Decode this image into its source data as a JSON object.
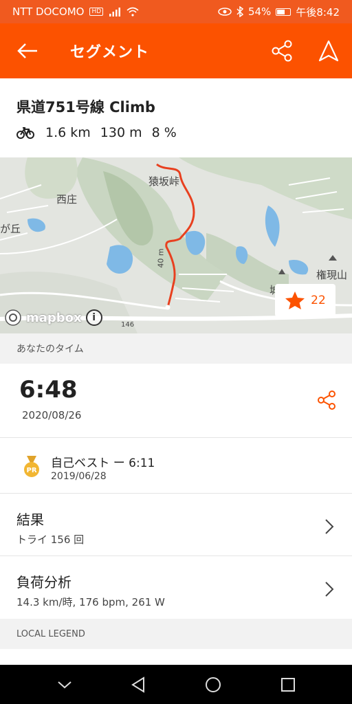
{
  "status_bar": {
    "carrier": "NTT DOCOMO",
    "hd": "HD",
    "battery": "54%",
    "battery_level": 0.54,
    "time": "午後8:42"
  },
  "app_bar": {
    "title": "セグメント"
  },
  "segment": {
    "name": "県道751号線 Climb",
    "distance": "1.6 km",
    "elevation": "130 m",
    "grade": "8 %"
  },
  "map": {
    "labels": {
      "nishi": "西庄",
      "ga_oka": "が丘",
      "sarusaka": "猿坂峠",
      "gongen": "権現山",
      "shiro": "城",
      "road": "146",
      "elev": "40 m"
    },
    "star_count": "22",
    "attribution": "mapbox",
    "route_color": "#e8401f"
  },
  "your_time": {
    "header": "あなたのタイム",
    "time": "6:48",
    "date": "2020/08/26"
  },
  "pr": {
    "badge": "PR",
    "title": "自己ベスト ー 6:11",
    "date": "2019/06/28"
  },
  "results": {
    "title": "結果",
    "sub": "トライ 156 回"
  },
  "analysis": {
    "title": "負荷分析",
    "sub": "14.3 km/時, 176 bpm, 261 W"
  },
  "local_legend": {
    "header": "LOCAL LEGEND"
  },
  "colors": {
    "accent": "#fc5200",
    "status": "#f05a1f",
    "gold": "#f2b632"
  }
}
